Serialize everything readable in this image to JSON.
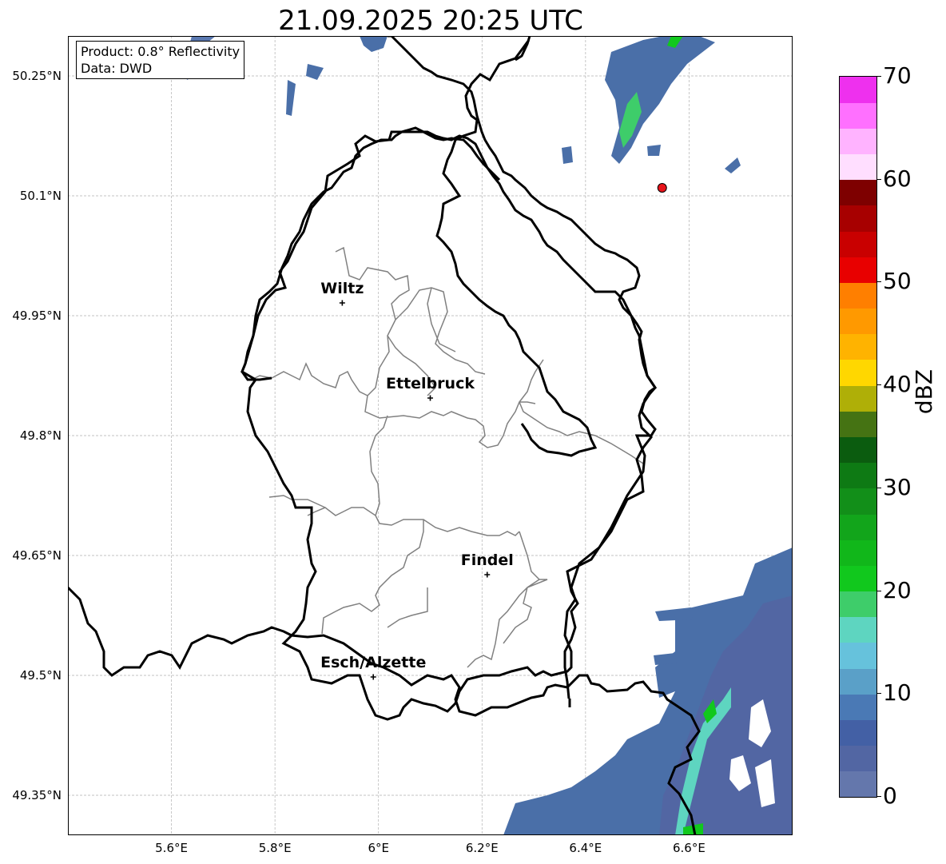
{
  "title": "21.09.2025 20:25 UTC",
  "info": {
    "product": "Product: 0.8° Reflectivity",
    "data": "Data: DWD"
  },
  "map": {
    "lat_range": [
      49.3,
      50.3
    ],
    "lon_range": [
      5.4,
      6.8
    ],
    "gridlines": true,
    "lat_ticks": [
      {
        "value": 50.25,
        "label": "50.25°N"
      },
      {
        "value": 50.1,
        "label": "50.1°N"
      },
      {
        "value": 49.95,
        "label": "49.95°N"
      },
      {
        "value": 49.8,
        "label": "49.8°N"
      },
      {
        "value": 49.65,
        "label": "49.65°N"
      },
      {
        "value": 49.5,
        "label": "49.5°N"
      },
      {
        "value": 49.35,
        "label": "49.35°N"
      }
    ],
    "lon_ticks": [
      {
        "value": 5.6,
        "label": "5.6°E"
      },
      {
        "value": 5.8,
        "label": "5.8°E"
      },
      {
        "value": 6.0,
        "label": "6°E"
      },
      {
        "value": 6.2,
        "label": "6.2°E"
      },
      {
        "value": 6.4,
        "label": "6.4°E"
      },
      {
        "value": 6.6,
        "label": "6.6°E"
      }
    ],
    "cities": [
      {
        "name": "Wiltz",
        "lon": 5.93,
        "lat": 49.966
      },
      {
        "name": "Ettelbruck",
        "lon": 6.1,
        "lat": 49.847
      },
      {
        "name": "Findel",
        "lon": 6.21,
        "lat": 49.626
      },
      {
        "name": "Esch/Alzette",
        "lon": 5.99,
        "lat": 49.498
      }
    ],
    "radar_site": {
      "lon": 6.548,
      "lat": 50.11,
      "color": "#e8141b"
    }
  },
  "colorbar": {
    "label": "dBZ",
    "min": 0,
    "max": 70,
    "ticks": [
      0,
      10,
      20,
      30,
      40,
      50,
      60,
      70
    ],
    "colors": [
      "#6477ac",
      "#5266a3",
      "#4360a5",
      "#4a79b5",
      "#5aa0c8",
      "#66c2dc",
      "#5ed5c0",
      "#3ecd6a",
      "#11c81d",
      "#11b71a",
      "#12a51b",
      "#128f19",
      "#0e7a14",
      "#0b5c0f",
      "#457313",
      "#afaf07",
      "#ffd700",
      "#ffb300",
      "#ff9900",
      "#ff7f00",
      "#e80000",
      "#c90000",
      "#a70000",
      "#7e0000",
      "#ffdeff",
      "#ffb3ff",
      "#ff70ff",
      "#ee30ee"
    ]
  }
}
